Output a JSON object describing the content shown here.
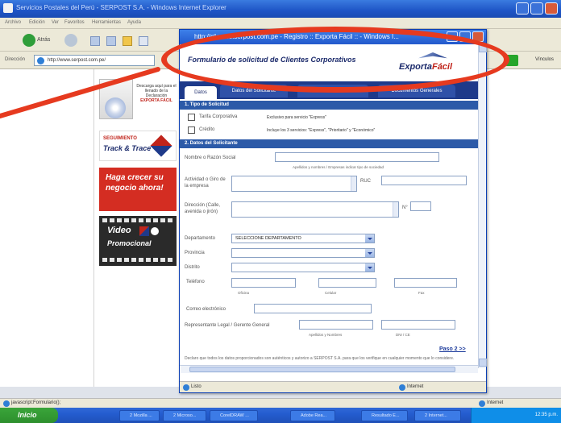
{
  "browser": {
    "title": "Servicios Postales del Perú - SERPOST S.A. - Windows Internet Explorer",
    "menu": [
      "Archivo",
      "Edición",
      "Ver",
      "Favoritos",
      "Herramientas",
      "Ayuda"
    ],
    "back_label": "Atrás",
    "address_label": "Dirección",
    "url": "http://www.serpost.com.pe/",
    "links_label": "Vínculos"
  },
  "left_panel": {
    "brochure_text": "Descarga aquí para el llenado de la Declaración",
    "brochure_brand": "EXPORTA FÁCIL",
    "track_kicker": "SEGUIMIENTO",
    "track_title": "Track & Trace",
    "promo_text": "Haga crecer su negocio ahora!",
    "video_line1": "Video",
    "video_line2": "Promocional"
  },
  "popup": {
    "title": "http://clientes.serpost.com.pe - Registro :: Exporta Fácil :: - Windows I...",
    "form_title": "Formulario de solicitud de Clientes Corporativos",
    "brand_main": "Exporta",
    "brand_accent": "Fácil",
    "tabs": [
      "Datos",
      "Datos del Solicitante",
      "Información Comercial",
      "Documentos Generales"
    ],
    "section1": "1. Tipo de Solicitud",
    "opt1_label": "Tarifa Corporativa",
    "opt1_note": "Exclusivo para servicio \"Express\"",
    "opt2_label": "Crédito",
    "opt2_note": "Incluye los 3 servicios: \"Express\", \"Prioritario\" y \"Económico\"",
    "section2": "2. Datos del Solicitante",
    "razon_label": "Nombre o Razón Social",
    "razon_hint": "Apellidos y nombres / Empresas indicar tipo de sociedad",
    "actividad_label": "Actividad o Giro de la empresa",
    "ruc_label": "RUC",
    "direccion_label": "Dirección (Calle, avenida o jirón)",
    "nro_label": "N°",
    "departamento_label": "Departamento",
    "departamento_value": "SELECCIONE DEPARTAMENTO",
    "provincia_label": "Provincia",
    "distrito_label": "Distrito",
    "telefono_label": "Teléfono",
    "tel_hints": [
      "Oficina",
      "Celular",
      "Fax"
    ],
    "correo_label": "Correo electrónico",
    "rep_label": "Representante Legal / Gerente General",
    "rep_hint1": "Apellidos y Nombres",
    "rep_hint2": "DNI / CE",
    "paso": "Paso 2 >>",
    "disclaimer": "Declaro que todos los datos proporcionados son auténticos y autorizo a SERPOST S.A. para que los verifique en cualquier momento que lo considere.",
    "status_left": "Listo",
    "status_right": "Internet"
  },
  "status": {
    "left": "javascript:Formulario();",
    "right": "Internet"
  },
  "taskbar": {
    "start": "Inicio",
    "tasks": [
      "2 Mozilla ...",
      "2 Microso...",
      "CorelDRAW ...",
      "Adobe Rea...",
      "Resultado E...",
      "2 Internet..."
    ],
    "clock": "12:35 p.m."
  },
  "colors": {
    "highlight": "#e63a1f",
    "brand_navy": "#1b2a6b",
    "brand_red": "#c0241b",
    "section_blue": "#2c5aa8"
  }
}
